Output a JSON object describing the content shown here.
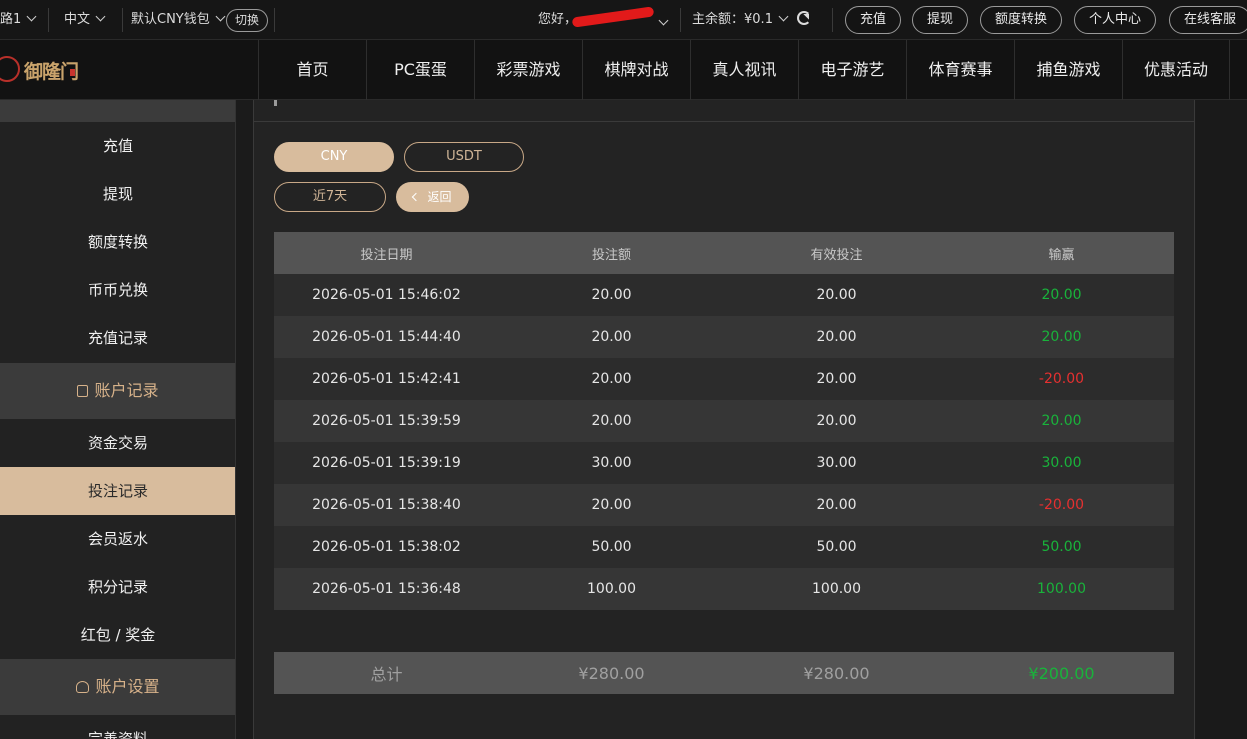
{
  "topbar": {
    "line_partial": "路1",
    "language": "中文",
    "wallet": "默认CNY钱包",
    "switch_label": "切换",
    "greeting": "您好，",
    "balance_label": "主余额：",
    "balance_value": "¥0.1",
    "buttons": [
      "充值",
      "提现",
      "额度转换",
      "个人中心",
      "在线客服"
    ]
  },
  "nav": {
    "logo_text": "御隆门",
    "items": [
      "首页",
      "PC蛋蛋",
      "彩票游戏",
      "棋牌对战",
      "真人视讯",
      "电子游艺",
      "体育赛事",
      "捕鱼游戏",
      "优惠活动"
    ]
  },
  "sidebar": {
    "group_funds_items": [
      "充值",
      "提现",
      "额度转换",
      "币币兑换",
      "充值记录"
    ],
    "group_records_title": "账户记录",
    "group_records_items": [
      "资金交易",
      "投注记录",
      "会员返水",
      "积分记录",
      "红包 / 奖金"
    ],
    "group_settings_title": "账户设置",
    "group_settings_items": [
      "完善资料"
    ],
    "active": "投注记录"
  },
  "content": {
    "currency_tabs": [
      "CNY",
      "USDT"
    ],
    "active_currency": "CNY",
    "range_label": "近7天",
    "back_label": "返回",
    "columns": [
      "投注日期",
      "投注额",
      "有效投注",
      "输赢"
    ],
    "rows": [
      {
        "date": "2026-05-01 15:46:02",
        "amount": "20.00",
        "valid": "20.00",
        "winloss": "20.00",
        "sign": "pos"
      },
      {
        "date": "2026-05-01 15:44:40",
        "amount": "20.00",
        "valid": "20.00",
        "winloss": "20.00",
        "sign": "pos"
      },
      {
        "date": "2026-05-01 15:42:41",
        "amount": "20.00",
        "valid": "20.00",
        "winloss": "-20.00",
        "sign": "neg"
      },
      {
        "date": "2026-05-01 15:39:59",
        "amount": "20.00",
        "valid": "20.00",
        "winloss": "20.00",
        "sign": "pos"
      },
      {
        "date": "2026-05-01 15:39:19",
        "amount": "30.00",
        "valid": "30.00",
        "winloss": "30.00",
        "sign": "pos"
      },
      {
        "date": "2026-05-01 15:38:40",
        "amount": "20.00",
        "valid": "20.00",
        "winloss": "-20.00",
        "sign": "neg"
      },
      {
        "date": "2026-05-01 15:38:02",
        "amount": "50.00",
        "valid": "50.00",
        "winloss": "50.00",
        "sign": "pos"
      },
      {
        "date": "2026-05-01 15:36:48",
        "amount": "100.00",
        "valid": "100.00",
        "winloss": "100.00",
        "sign": "pos"
      }
    ],
    "total": {
      "label": "总计",
      "amount": "¥280.00",
      "valid": "¥280.00",
      "winloss": "¥200.00"
    }
  },
  "colors": {
    "accent": "#d8bc9d",
    "win": "#19b33b",
    "loss": "#e53030"
  }
}
